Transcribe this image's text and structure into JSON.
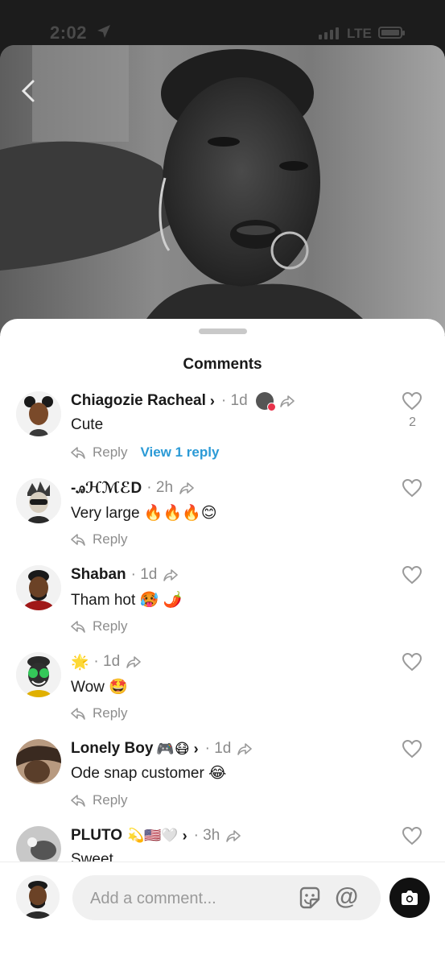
{
  "status_bar": {
    "time": "2:02",
    "network": "LTE"
  },
  "sheet": {
    "title": "Comments"
  },
  "comments": [
    {
      "name": "Chiagozie Racheal",
      "has_chevron": true,
      "time": "· 1d",
      "text": "Cute",
      "reply_label": "Reply",
      "view_replies": "View 1 reply",
      "likes": "2"
    },
    {
      "name": "-ꭿℋℳℰD",
      "has_chevron": false,
      "time": "· 2h",
      "text": "Very large 🔥🔥🔥😊",
      "reply_label": "Reply",
      "likes": ""
    },
    {
      "name": "Shaban",
      "has_chevron": false,
      "time": "· 1d",
      "text": "Tham hot 🥵 🌶️",
      "reply_label": "Reply",
      "likes": ""
    },
    {
      "name": "",
      "name_emoji": "🌟",
      "has_chevron": false,
      "time": "· 1d",
      "text": "Wow 🤩",
      "reply_label": "Reply",
      "likes": ""
    },
    {
      "name": "Lonely Boy",
      "name_emoji": "🎮😷",
      "has_chevron": true,
      "time": "· 1d",
      "text": "Ode snap customer 😂",
      "reply_label": "Reply",
      "likes": ""
    },
    {
      "name": "PLUTO",
      "name_emoji": "💫🇺🇸🤍",
      "has_chevron": true,
      "time": "· 3h",
      "text": "Sweet",
      "likes": ""
    }
  ],
  "composer": {
    "placeholder": "Add a comment...",
    "at_symbol": "@"
  },
  "colors": {
    "link": "#2b9ad6",
    "muted": "#8a8a8a",
    "background": "#ffffff"
  }
}
